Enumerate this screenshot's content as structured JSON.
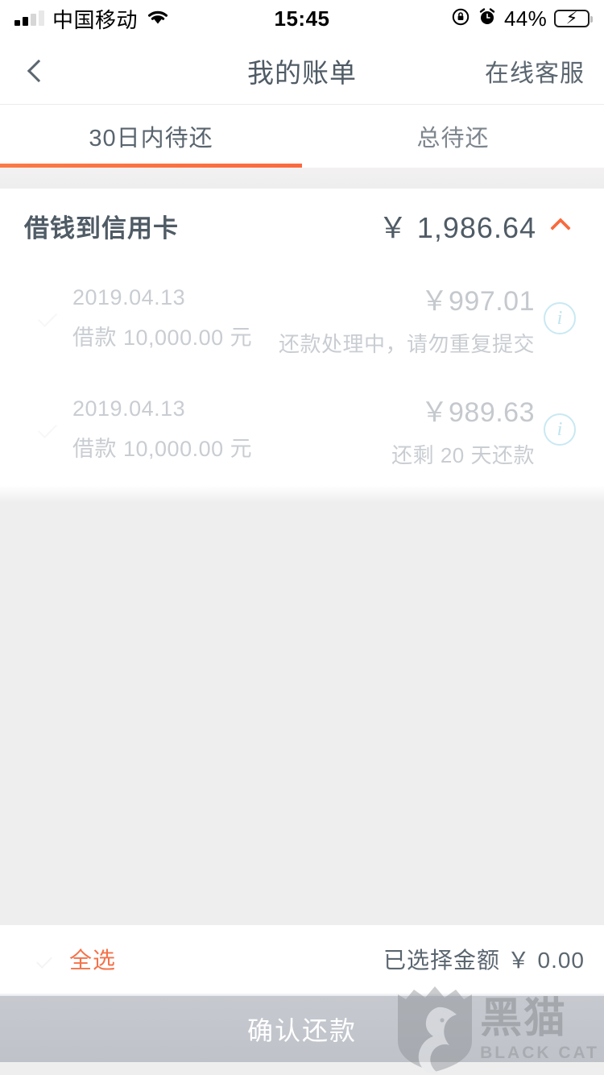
{
  "status_bar": {
    "carrier": "中国移动",
    "wifi_icon": "wifi-icon",
    "time": "15:45",
    "rotation_lock_icon": "rotation-lock-icon",
    "alarm_icon": "alarm-clock-icon",
    "battery_percent": "44%",
    "battery_level": 44,
    "battery_charging_icon": "charging-bolt-icon"
  },
  "nav": {
    "back_icon": "chevron-left-icon",
    "title": "我的账单",
    "action_label": "在线客服"
  },
  "tabs": [
    {
      "label": "30日内待还",
      "active": true
    },
    {
      "label": "总待还",
      "active": false
    }
  ],
  "card": {
    "title": "借钱到信用卡",
    "total_amount": "￥ 1,986.64",
    "collapse_icon": "chevron-up-icon",
    "rows": [
      {
        "checkbox_icon": "checkbox-unchecked-icon",
        "date": "2019.04.13",
        "principal": "借款 10,000.00 元",
        "amount": "￥997.01",
        "status": "还款处理中，请勿重复提交",
        "info_icon": "info-circle-icon",
        "info_glyph": "i"
      },
      {
        "checkbox_icon": "checkbox-unchecked-icon",
        "date": "2019.04.13",
        "principal": "借款 10,000.00 元",
        "amount": "￥989.63",
        "status": "还剩 20 天还款",
        "info_icon": "info-circle-icon",
        "info_glyph": "i"
      }
    ]
  },
  "bottom": {
    "select_all_checkbox_icon": "checkbox-unchecked-icon",
    "select_all_label": "全选",
    "selected_amount_label": "已选择金额 ￥ 0.00",
    "confirm_label": "确认还款"
  },
  "watermark": {
    "shield_icon": "black-cat-shield-icon",
    "cn_text": "黑猫",
    "en_text": "BLACK CAT"
  },
  "colors": {
    "accent_orange": "#f96a3d",
    "select_all_orange": "#f4724a",
    "text_dark": "#4f5b65",
    "text_muted": "#c9cdd2",
    "info_cyan": "#c9e9f2",
    "page_bg": "#eeeeee",
    "disabled_button": "#c2c6cc",
    "battery_green": "#31d158"
  }
}
